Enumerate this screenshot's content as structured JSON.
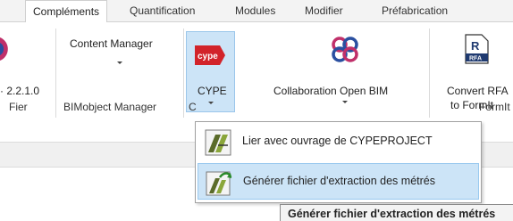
{
  "tabs": [
    "Compléments",
    "Quantification",
    "Modules",
    "Modifier",
    "Préfabrication"
  ],
  "ribbon": {
    "left_partial_label": "· 2.2.1.0",
    "content_manager_label": "Content Manager",
    "cype_label": "CYPE",
    "cype_logo_text": "cype",
    "collab_label": "Collaboration Open BIM",
    "convert_label_line1": "Convert RFA",
    "convert_label_line2": "to FormIt",
    "rfa_badge": "RFA"
  },
  "groups": {
    "g1": "Fier",
    "g2": "BIMobject Manager",
    "g3": "C",
    "g4": "FormIt"
  },
  "dropdown": {
    "items": [
      "Lier avec ouvrage de CYPEPROJECT",
      "Générer fichier d'extraction des métrés"
    ]
  },
  "tooltip": "Générer fichier d'extraction des métrés",
  "colors": {
    "accent_hover": "#cce4f7",
    "cype_red": "#d2232a",
    "collab_pink": "#c0306a",
    "collab_blue": "#2a4fa0",
    "rfa_navy": "#1f3a70"
  }
}
